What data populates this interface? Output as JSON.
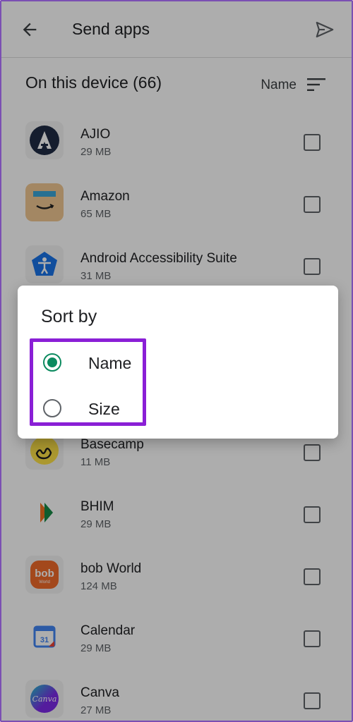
{
  "appbar": {
    "title": "Send apps",
    "back_icon": "arrow-left-icon",
    "send_icon": "send-icon"
  },
  "section": {
    "heading": "On this device (66)",
    "sort_label": "Name",
    "sort_icon": "sort-icon"
  },
  "apps": [
    {
      "name": "AJIO",
      "size": "29 MB",
      "icon": "ajio-icon",
      "color": "#1f2b44"
    },
    {
      "name": "Amazon",
      "size": "65 MB",
      "icon": "amazon-icon",
      "color": "#f0c892"
    },
    {
      "name": "Android Accessibility Suite",
      "size": "31 MB",
      "icon": "accessibility-icon",
      "color": "#1a73e8"
    },
    {
      "name": "",
      "size": "",
      "icon": "hidden-app-icon",
      "color": "#e8e8e8"
    },
    {
      "name": "",
      "size": "",
      "icon": "hidden-app-icon",
      "color": "#e8e8e8"
    },
    {
      "name": "Basecamp",
      "size": "11 MB",
      "icon": "basecamp-icon",
      "color": "#fde047"
    },
    {
      "name": "BHIM",
      "size": "29 MB",
      "icon": "bhim-icon",
      "color": "#ffffff"
    },
    {
      "name": "bob World",
      "size": "124 MB",
      "icon": "bob-world-icon",
      "color": "#f06b2a"
    },
    {
      "name": "Calendar",
      "size": "29 MB",
      "icon": "calendar-icon",
      "color": "#ffffff"
    },
    {
      "name": "Canva",
      "size": "27 MB",
      "icon": "canva-icon",
      "color": "#3b82f6"
    }
  ],
  "dialog": {
    "title": "Sort by",
    "options": [
      {
        "label": "Name",
        "selected": true
      },
      {
        "label": "Size",
        "selected": false
      }
    ],
    "accent": "#0b8a5f",
    "highlight_color": "#8a1fd6"
  }
}
